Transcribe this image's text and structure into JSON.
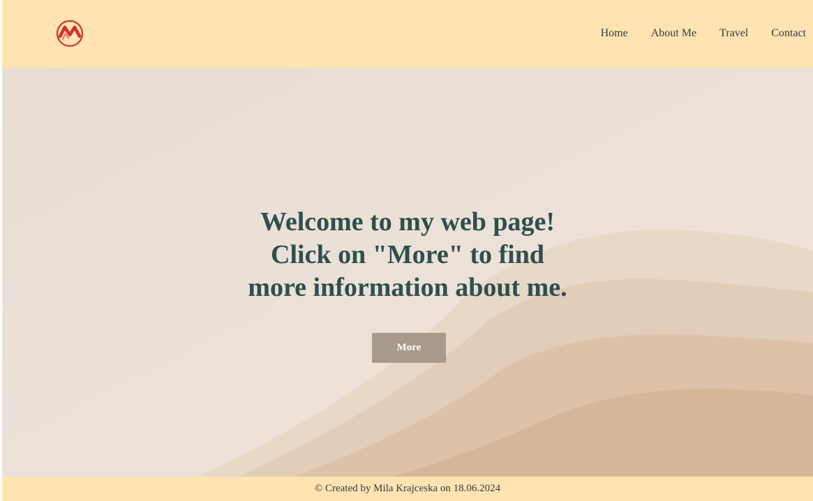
{
  "header": {
    "logo_icon": "m-circle-logo-icon",
    "nav": [
      {
        "label": "Home"
      },
      {
        "label": "About Me"
      },
      {
        "label": "Travel"
      },
      {
        "label": "Contact"
      }
    ]
  },
  "hero": {
    "title_lines": [
      "Welcome to my web page!",
      "Click on \"More\" to find",
      "more information about me."
    ],
    "button_label": "More"
  },
  "footer": {
    "text": "© Created by Mila Krajceska on 18.06.2024"
  },
  "colors": {
    "header_bg": "#ffe4b2",
    "hero_bg": "#ece1d8",
    "title": "#2f4f4f",
    "button_bg": "#a89a8d",
    "logo_red": "#d32f2f"
  }
}
